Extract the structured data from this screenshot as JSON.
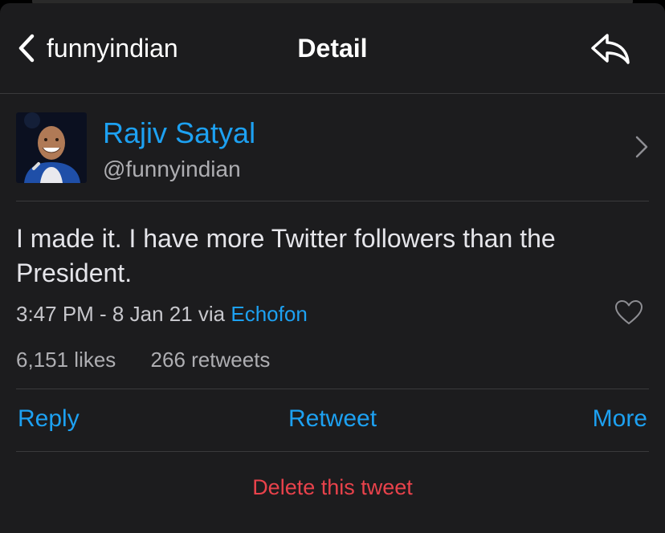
{
  "navbar": {
    "back_label": "funnyindian",
    "title": "Detail",
    "back_icon": "chevron-left-icon",
    "reply_icon": "reply-arrow-icon"
  },
  "profile": {
    "display_name": "Rajiv Satyal",
    "handle": "@funnyindian",
    "avatar": "avatar-photo",
    "chevron_icon": "chevron-right-icon"
  },
  "tweet": {
    "text": "I made it. I have more Twitter followers than the President.",
    "timestamp": "3:47 PM - 8 Jan 21 via",
    "source": "Echofon",
    "heart_icon": "heart-outline-icon"
  },
  "stats": {
    "likes": "6,151 likes",
    "retweets": "266 retweets"
  },
  "actions": {
    "reply": "Reply",
    "retweet": "Retweet",
    "more": "More"
  },
  "delete_label": "Delete this tweet",
  "colors": {
    "background": "#1c1c1e",
    "accent": "#1da1f2",
    "destructive": "#e8424b",
    "separator": "#3a3a3c"
  }
}
